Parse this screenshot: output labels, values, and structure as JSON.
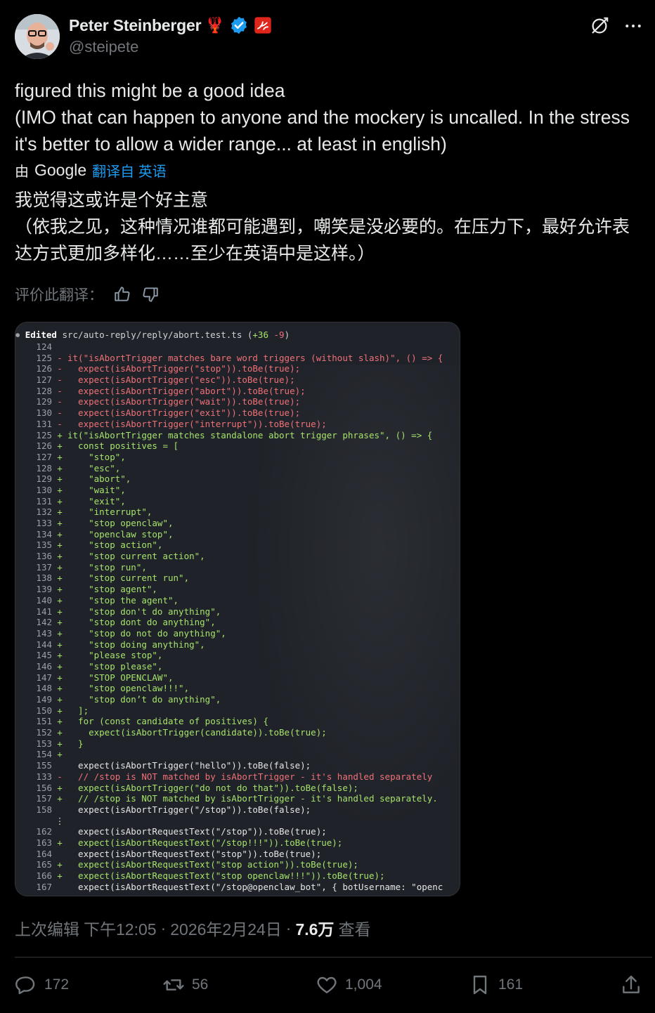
{
  "author": {
    "display_name": "Peter Steinberger",
    "handle": "@steipete",
    "badge_emoji": "🦞"
  },
  "tweet": {
    "lines": [
      "figured this might be a good idea",
      "(IMO that can happen to anyone and the mockery is uncalled. In the stress it's better to allow a wider range... at least in english)"
    ]
  },
  "translation": {
    "by_label": "由",
    "google_label": "Google",
    "link_label": "翻译自 英语",
    "lines": [
      "我觉得这或许是个好主意",
      "（依我之见，这种情况谁都可能遇到，嘲笑是没必要的。在压力下，最好允许表达方式更加多样化……至少在英语中是这样。）"
    ],
    "rate_label": "评价此翻译："
  },
  "code": {
    "head_label": "Edited",
    "file": "src/auto-reply/reply/abort.test.ts",
    "stats_add": "+36",
    "stats_del": "-9",
    "lines": [
      {
        "n": "124",
        "m": "",
        "t": "",
        "k": "ctx"
      },
      {
        "n": "125",
        "m": "-",
        "t": "it(\"isAbortTrigger matches bare word triggers (without slash)\", () => {",
        "k": "del"
      },
      {
        "n": "126",
        "m": "-",
        "t": "  expect(isAbortTrigger(\"stop\")).toBe(true);",
        "k": "del"
      },
      {
        "n": "127",
        "m": "-",
        "t": "  expect(isAbortTrigger(\"esc\")).toBe(true);",
        "k": "del"
      },
      {
        "n": "128",
        "m": "-",
        "t": "  expect(isAbortTrigger(\"abort\")).toBe(true);",
        "k": "del"
      },
      {
        "n": "129",
        "m": "-",
        "t": "  expect(isAbortTrigger(\"wait\")).toBe(true);",
        "k": "del"
      },
      {
        "n": "130",
        "m": "-",
        "t": "  expect(isAbortTrigger(\"exit\")).toBe(true);",
        "k": "del"
      },
      {
        "n": "131",
        "m": "-",
        "t": "  expect(isAbortTrigger(\"interrupt\")).toBe(true);",
        "k": "del"
      },
      {
        "n": "125",
        "m": "+",
        "t": "it(\"isAbortTrigger matches standalone abort trigger phrases\", () => {",
        "k": "add"
      },
      {
        "n": "126",
        "m": "+",
        "t": "  const positives = [",
        "k": "add"
      },
      {
        "n": "127",
        "m": "+",
        "t": "    \"stop\",",
        "k": "add"
      },
      {
        "n": "128",
        "m": "+",
        "t": "    \"esc\",",
        "k": "add"
      },
      {
        "n": "129",
        "m": "+",
        "t": "    \"abort\",",
        "k": "add"
      },
      {
        "n": "130",
        "m": "+",
        "t": "    \"wait\",",
        "k": "add"
      },
      {
        "n": "131",
        "m": "+",
        "t": "    \"exit\",",
        "k": "add"
      },
      {
        "n": "132",
        "m": "+",
        "t": "    \"interrupt\",",
        "k": "add"
      },
      {
        "n": "133",
        "m": "+",
        "t": "    \"stop openclaw\",",
        "k": "add"
      },
      {
        "n": "134",
        "m": "+",
        "t": "    \"openclaw stop\",",
        "k": "add"
      },
      {
        "n": "135",
        "m": "+",
        "t": "    \"stop action\",",
        "k": "add"
      },
      {
        "n": "136",
        "m": "+",
        "t": "    \"stop current action\",",
        "k": "add"
      },
      {
        "n": "137",
        "m": "+",
        "t": "    \"stop run\",",
        "k": "add"
      },
      {
        "n": "138",
        "m": "+",
        "t": "    \"stop current run\",",
        "k": "add"
      },
      {
        "n": "139",
        "m": "+",
        "t": "    \"stop agent\",",
        "k": "add"
      },
      {
        "n": "140",
        "m": "+",
        "t": "    \"stop the agent\",",
        "k": "add"
      },
      {
        "n": "141",
        "m": "+",
        "t": "    \"stop don't do anything\",",
        "k": "add"
      },
      {
        "n": "142",
        "m": "+",
        "t": "    \"stop dont do anything\",",
        "k": "add"
      },
      {
        "n": "143",
        "m": "+",
        "t": "    \"stop do not do anything\",",
        "k": "add"
      },
      {
        "n": "144",
        "m": "+",
        "t": "    \"stop doing anything\",",
        "k": "add"
      },
      {
        "n": "145",
        "m": "+",
        "t": "    \"please stop\",",
        "k": "add"
      },
      {
        "n": "146",
        "m": "+",
        "t": "    \"stop please\",",
        "k": "add"
      },
      {
        "n": "147",
        "m": "+",
        "t": "    \"STOP OPENCLAW\",",
        "k": "add"
      },
      {
        "n": "148",
        "m": "+",
        "t": "    \"stop openclaw!!!\",",
        "k": "add"
      },
      {
        "n": "149",
        "m": "+",
        "t": "    \"stop don’t do anything\",",
        "k": "add"
      },
      {
        "n": "150",
        "m": "+",
        "t": "  ];",
        "k": "add"
      },
      {
        "n": "151",
        "m": "+",
        "t": "  for (const candidate of positives) {",
        "k": "add"
      },
      {
        "n": "152",
        "m": "+",
        "t": "    expect(isAbortTrigger(candidate)).toBe(true);",
        "k": "add"
      },
      {
        "n": "153",
        "m": "+",
        "t": "  }",
        "k": "add"
      },
      {
        "n": "154",
        "m": "+",
        "t": "",
        "k": "add"
      },
      {
        "n": "155",
        "m": "",
        "t": "  expect(isAbortTrigger(\"hello\")).toBe(false);",
        "k": "ctx"
      },
      {
        "n": "133",
        "m": "-",
        "t": "  // /stop is NOT matched by isAbortTrigger - it's handled separately",
        "k": "del"
      },
      {
        "n": "156",
        "m": "+",
        "t": "  expect(isAbortTrigger(\"do not do that\")).toBe(false);",
        "k": "add"
      },
      {
        "n": "157",
        "m": "+",
        "t": "  // /stop is NOT matched by isAbortTrigger - it's handled separately.",
        "k": "add"
      },
      {
        "n": "158",
        "m": "",
        "t": "  expect(isAbortTrigger(\"/stop\")).toBe(false);",
        "k": "ctx"
      },
      {
        "n": "",
        "m": "⋮",
        "t": "",
        "k": "ell"
      },
      {
        "n": "162",
        "m": "",
        "t": "  expect(isAbortRequestText(\"/stop\")).toBe(true);",
        "k": "ctx"
      },
      {
        "n": "163",
        "m": "+",
        "t": "  expect(isAbortRequestText(\"/stop!!!\")).toBe(true);",
        "k": "add"
      },
      {
        "n": "164",
        "m": "",
        "t": "  expect(isAbortRequestText(\"stop\")).toBe(true);",
        "k": "ctx"
      },
      {
        "n": "165",
        "m": "+",
        "t": "  expect(isAbortRequestText(\"stop action\")).toBe(true);",
        "k": "add"
      },
      {
        "n": "166",
        "m": "+",
        "t": "  expect(isAbortRequestText(\"stop openclaw!!!\")).toBe(true);",
        "k": "add"
      },
      {
        "n": "167",
        "m": "",
        "t": "  expect(isAbortRequestText(\"/stop@openclaw_bot\", { botUsername: \"openc",
        "k": "ctx"
      }
    ]
  },
  "meta": {
    "edited_label": "上次编辑",
    "time": "下午12:05",
    "sep1": "·",
    "date": "2026年2月24日",
    "sep2": "·",
    "views_count": "7.6万",
    "views_label": "查看"
  },
  "actions": {
    "replies": "172",
    "reposts": "56",
    "likes": "1,004",
    "bookmarks": "161"
  },
  "colors": {
    "accent": "#1d9bf0",
    "added": "#a6e36b",
    "removed": "#f07178",
    "muted": "#71767b"
  }
}
